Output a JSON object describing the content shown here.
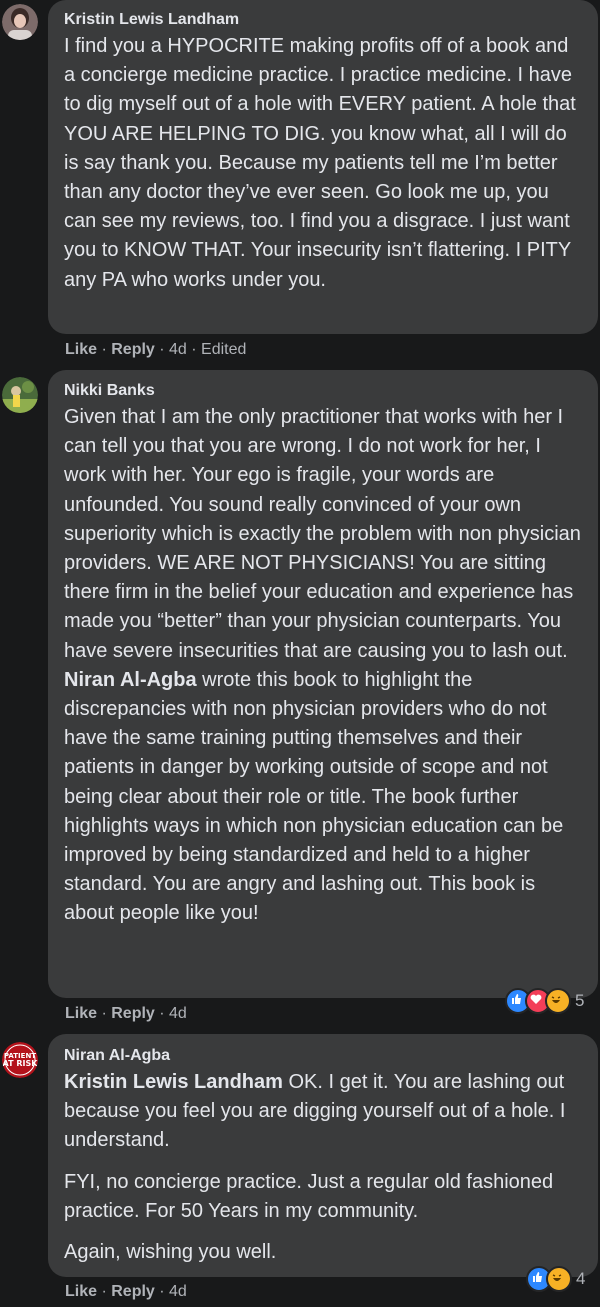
{
  "comments": [
    {
      "author": "Kristin Lewis Landham",
      "paragraphs": [
        "I find you a HYPOCRITE making profits off of a book and a concierge medicine practice. I practice medicine. I have to dig myself out of a hole with EVERY patient. A hole that YOU ARE HELPING TO DIG. you know what, all I will do is say thank you. Because my patients tell me I’m better than any doctor they’ve ever seen. Go look me up, you can see my reviews, too. I find you a disgrace. I just want you to KNOW THAT. Your insecurity isn’t flattering. I PITY any PA who works under you."
      ],
      "like": "Like",
      "reply": "Reply",
      "time": "4d",
      "edited": "Edited"
    },
    {
      "author": "Nikki Banks",
      "text_before": "Given that I am the only practitioner that works with her I can tell you that you are wrong. I do not work for her, I work with her. Your ego is fragile, your words are unfounded. You sound really convinced of your own superiority which is exactly the problem with non physician providers. WE ARE NOT PHYSICIANS! You are sitting there firm in the belief your education and experience has made you “better” than your physician counterparts. You have severe insecurities that are causing you to lash out.",
      "mention": "Niran Al-Agba",
      "text_after": " wrote this book to highlight the discrepancies with non physician providers who do not have the same training putting themselves and their patients in danger by working outside of scope and not being clear about their role or title. The book further highlights ways in which non physician education can be improved by being standardized and held to a higher standard. You are angry and lashing out. This book is about people like you!",
      "like": "Like",
      "reply": "Reply",
      "time": "4d",
      "reaction_count": "5"
    },
    {
      "author": "Niran Al-Agba",
      "mention": "Kristin Lewis Landham",
      "p1_after": " OK. I get it. You are lashing out because you feel you are digging yourself out of a hole. I understand.",
      "p2": "FYI, no concierge practice. Just a regular old fashioned practice. For 50 Years in my community.",
      "p3": "Again, wishing you well.",
      "like": "Like",
      "reply": "Reply",
      "time": "4d",
      "reaction_count": "4"
    }
  ],
  "separator": " · ",
  "colors": {
    "background": "#18191a",
    "bubble": "#3a3b3c",
    "text": "#e4e6eb",
    "secondary": "#b0b3b8",
    "like_blue": "#2d88ff",
    "love_red": "#f33e58",
    "haha_yellow": "#f7b125"
  },
  "avatar_text": "PATIENT AT RISK"
}
